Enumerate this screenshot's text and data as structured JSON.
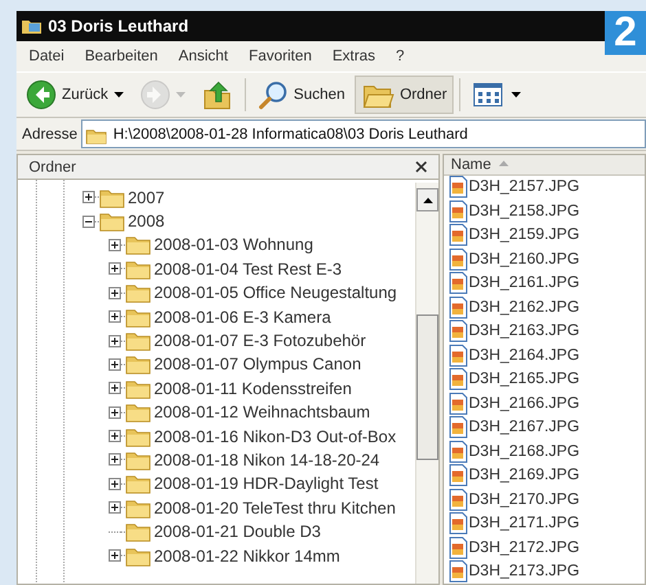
{
  "window": {
    "title": "03 Doris Leuthard"
  },
  "badge": "2",
  "menu": [
    "Datei",
    "Bearbeiten",
    "Ansicht",
    "Favoriten",
    "Extras",
    "?"
  ],
  "toolbar": [
    {
      "kind": "back",
      "label": "Zurück",
      "disabled": false,
      "selected": false
    },
    {
      "kind": "forward",
      "disabled": true,
      "selected": false
    },
    {
      "kind": "up",
      "disabled": false,
      "selected": false
    },
    {
      "kind": "search",
      "label": "Suchen",
      "disabled": false,
      "selected": false
    },
    {
      "kind": "folders",
      "label": "Ordner",
      "disabled": false,
      "selected": true
    },
    {
      "kind": "views",
      "disabled": false,
      "selected": false
    }
  ],
  "address": {
    "label": "Adresse",
    "value": "H:\\2008\\2008-01-28 Informatica08\\03 Doris Leuthard"
  },
  "folder_pane": {
    "title": "Ordner",
    "tree": [
      {
        "label": "2007",
        "expandable": true,
        "expanded": false
      },
      {
        "label": "2008",
        "expandable": true,
        "expanded": true,
        "children": [
          {
            "label": "2008-01-03 Wohnung",
            "expandable": true
          },
          {
            "label": "2008-01-04 Test Rest E-3",
            "expandable": true
          },
          {
            "label": "2008-01-05 Office Neugestaltung",
            "expandable": true
          },
          {
            "label": "2008-01-06 E-3 Kamera",
            "expandable": true
          },
          {
            "label": "2008-01-07 E-3 Fotozubehör",
            "expandable": true
          },
          {
            "label": "2008-01-07 Olympus Canon",
            "expandable": true
          },
          {
            "label": "2008-01-11 Kodensstreifen",
            "expandable": true
          },
          {
            "label": "2008-01-12 Weihnachtsbaum",
            "expandable": true
          },
          {
            "label": "2008-01-16 Nikon-D3 Out-of-Box",
            "expandable": true
          },
          {
            "label": "2008-01-18 Nikon 14-18-20-24",
            "expandable": true
          },
          {
            "label": "2008-01-19 HDR-Daylight Test",
            "expandable": true
          },
          {
            "label": "2008-01-20 TeleTest thru Kitchen",
            "expandable": true
          },
          {
            "label": "2008-01-21 Double D3",
            "expandable": false
          },
          {
            "label": "2008-01-22 Nikkor 14mm",
            "expandable": true
          }
        ]
      }
    ]
  },
  "file_list": {
    "columns": [
      "Name"
    ],
    "files": [
      "D3H_2157.JPG",
      "D3H_2158.JPG",
      "D3H_2159.JPG",
      "D3H_2160.JPG",
      "D3H_2161.JPG",
      "D3H_2162.JPG",
      "D3H_2163.JPG",
      "D3H_2164.JPG",
      "D3H_2165.JPG",
      "D3H_2166.JPG",
      "D3H_2167.JPG",
      "D3H_2168.JPG",
      "D3H_2169.JPG",
      "D3H_2170.JPG",
      "D3H_2171.JPG",
      "D3H_2172.JPG",
      "D3H_2173.JPG"
    ]
  }
}
